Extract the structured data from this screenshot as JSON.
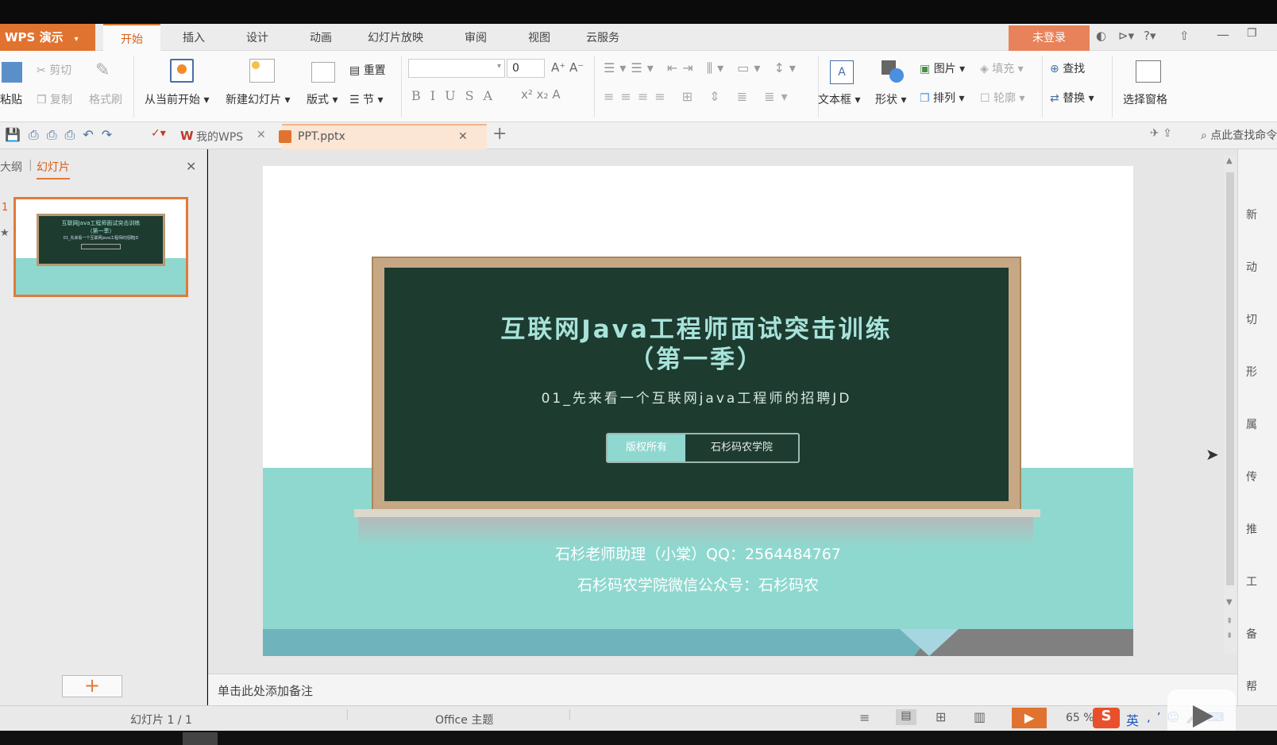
{
  "app": {
    "menu_label": "WPS 演示",
    "login_label": "未登录"
  },
  "tabs": [
    "开始",
    "插入",
    "设计",
    "动画",
    "幻灯片放映",
    "审阅",
    "视图",
    "云服务"
  ],
  "ribbon": {
    "paste": "粘贴",
    "cut": "剪切",
    "copy": "复制",
    "format_painter": "格式刷",
    "from_current": "从当前开始",
    "new_slide": "新建幻灯片",
    "layout": "版式",
    "reset": "重置",
    "section": "节",
    "font_size": "0",
    "text_box": "文本框",
    "shape": "形状",
    "picture": "图片",
    "fill": "填充",
    "arrange": "排列",
    "outline": "轮廓",
    "find": "查找",
    "replace": "替换",
    "selection_pane": "选择窗格"
  },
  "doc_tabs": {
    "home": "我的WPS",
    "file": "PPT.pptx",
    "search": "点此查找命令"
  },
  "left_panel": {
    "outline_tab": "大纲",
    "slides_tab": "幻灯片",
    "slide_number": "1"
  },
  "slide": {
    "title_line1": "互联网Java工程师面试突击训练",
    "title_line2": "（第一季）",
    "subtitle": "01_先来看一个互联网java工程师的招聘JD",
    "badge_left": "版权所有",
    "badge_right": "石杉码农学院",
    "contact_line1": "石杉老师助理（小棠）QQ：2564484767",
    "contact_line2": "石杉码农学院微信公众号：石杉码农"
  },
  "thumb": {
    "line1": "互联网Java工程师面试突击训练",
    "line2": "（第一季）",
    "line3": "01_先来看一个互联网java工程师的招聘JD"
  },
  "notes_placeholder": "单击此处添加备注",
  "status": {
    "slide_count": "幻灯片 1 / 1",
    "theme": "Office 主题",
    "zoom": "65 %",
    "ime_label": "英"
  },
  "right_rail": [
    "新",
    "动",
    "切",
    "形",
    "属",
    "传",
    "推",
    "工",
    "备",
    "帮"
  ],
  "colors": {
    "accent": "#e0732f",
    "chalkboard": "#1e3b30",
    "teal": "#8fd8cf",
    "title_text": "#a7e3da"
  }
}
